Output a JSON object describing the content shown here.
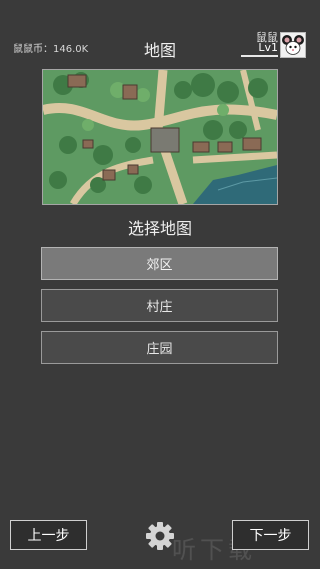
{
  "header": {
    "currency_text": "鼠鼠币：146.0K",
    "title": "地图",
    "player_name": "鼠鼠",
    "player_level": "Lv1"
  },
  "map_preview": {
    "image": "top-down-town-map"
  },
  "section": {
    "title": "选择地图"
  },
  "maps": [
    {
      "label": "郊区",
      "selected": true
    },
    {
      "label": "村庄",
      "selected": false
    },
    {
      "label": "庄园",
      "selected": false
    }
  ],
  "footer": {
    "prev_label": "上一步",
    "next_label": "下一步",
    "settings_icon": "gear-icon"
  },
  "watermark": {
    "text": "听下载"
  },
  "colors": {
    "background": "#3a3a3a",
    "selected_button": "#7a7a7a",
    "button": "#4a4a4a"
  }
}
